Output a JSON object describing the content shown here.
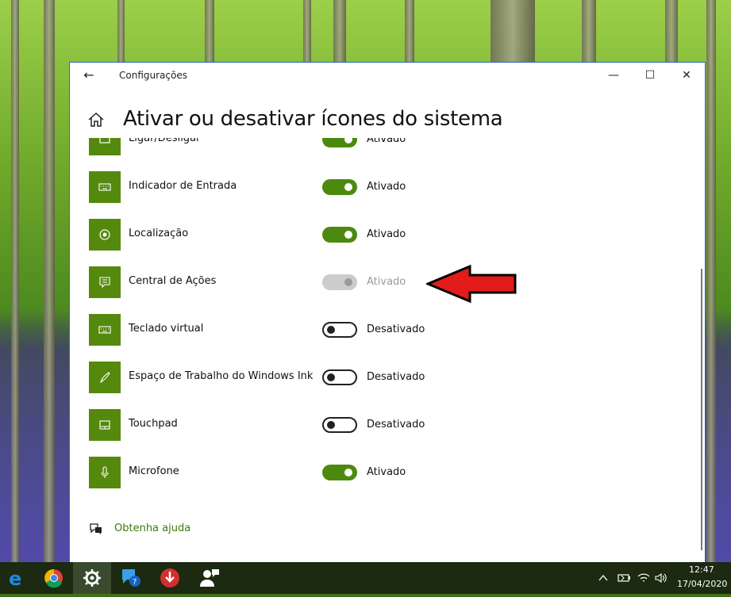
{
  "window": {
    "app_title": "Configurações",
    "page_title": "Ativar ou desativar ícones do sistema",
    "minimize_glyph": "—",
    "maximize_glyph": "☐",
    "close_glyph": "✕",
    "back_glyph": "←"
  },
  "items": [
    {
      "label": "Ligar/Desligar",
      "state": "Ativado",
      "toggle": "on",
      "icon": "power-icon"
    },
    {
      "label": "Indicador de Entrada",
      "state": "Ativado",
      "toggle": "on",
      "icon": "keyboard-icon"
    },
    {
      "label": "Localização",
      "state": "Ativado",
      "toggle": "on",
      "icon": "location-icon"
    },
    {
      "label": "Central de Ações",
      "state": "Ativado",
      "toggle": "disabled",
      "icon": "action-center-icon"
    },
    {
      "label": "Teclado virtual",
      "state": "Desativado",
      "toggle": "off",
      "icon": "keyboard-icon"
    },
    {
      "label": "Espaço de Trabalho do Windows Ink",
      "state": "Desativado",
      "toggle": "off",
      "icon": "pen-icon"
    },
    {
      "label": "Touchpad",
      "state": "Desativado",
      "toggle": "off",
      "icon": "touchpad-icon"
    },
    {
      "label": "Microfone",
      "state": "Ativado",
      "toggle": "on",
      "icon": "microphone-icon"
    }
  ],
  "help": {
    "label": "Obtenha ajuda"
  },
  "taskbar": {
    "time": "12:47",
    "date": "17/04/2020"
  },
  "colors": {
    "accent": "#4c8a0f",
    "tile": "#55890e",
    "arrow": "#e31b1b"
  }
}
